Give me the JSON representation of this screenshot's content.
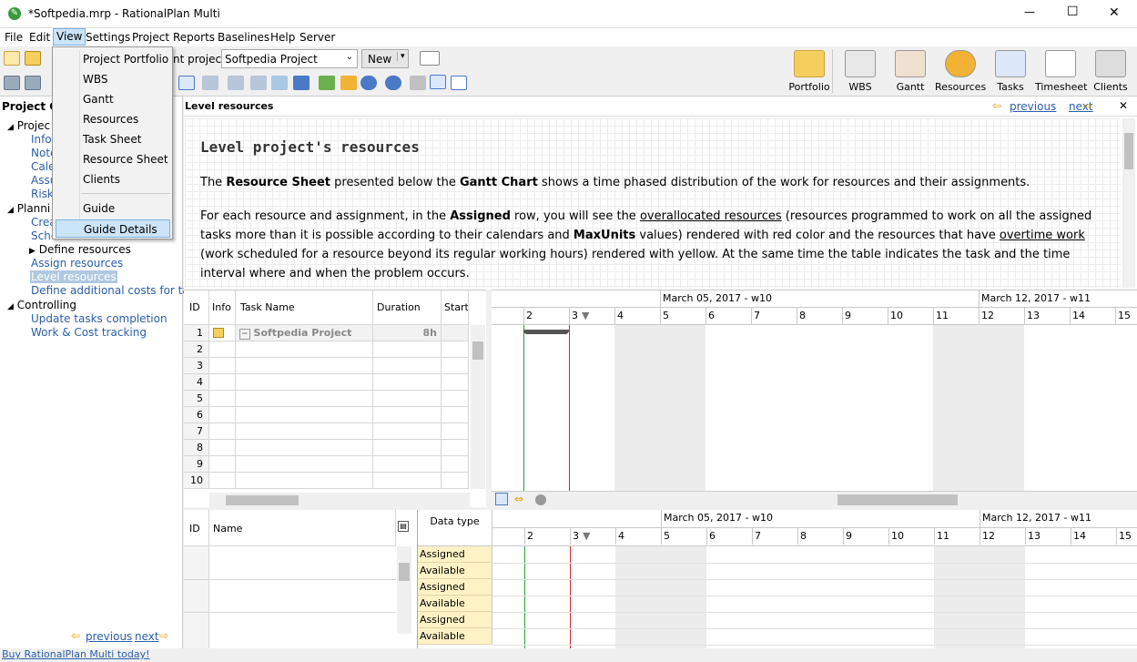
{
  "window": {
    "title": "*Softpedia.mrp - RationalPlan Multi",
    "minimize": "—",
    "maximize": "☐",
    "close": "✕"
  },
  "menu": [
    "File",
    "Edit",
    "View",
    "Settings",
    "Project",
    "Reports",
    "Baselines",
    "Help",
    "Server"
  ],
  "toolbar": {
    "project_label": "nt project:",
    "project_value": "Softpedia Project",
    "new_label": "New"
  },
  "big_buttons": [
    "Portfolio",
    "WBS",
    "Gantt",
    "Resources",
    "Tasks",
    "Timesheet",
    "Clients"
  ],
  "view_menu": {
    "items": [
      "Project Portfolio",
      "WBS",
      "Gantt",
      "Resources",
      "Task Sheet",
      "Resource Sheet",
      "Clients",
      "Guide",
      "Guide Details"
    ]
  },
  "sidebar": {
    "header": "Project Gu",
    "tree": [
      {
        "text": "Projec",
        "indent": 0,
        "expand": "open"
      },
      {
        "text": "Info",
        "indent": 1,
        "link": true
      },
      {
        "text": "Note",
        "indent": 1,
        "link": true
      },
      {
        "text": "Cale",
        "indent": 1,
        "link": true
      },
      {
        "text": "Assu",
        "indent": 1,
        "link": true
      },
      {
        "text": "Risks",
        "indent": 1,
        "link": true
      },
      {
        "text": "Planni",
        "indent": 0,
        "expand": "open"
      },
      {
        "text": "Crea",
        "indent": 1,
        "link": true
      },
      {
        "text": "Sche",
        "indent": 1,
        "link": true
      },
      {
        "text": "Define resources",
        "indent": 1,
        "expand": "closed"
      },
      {
        "text": "Assign resources",
        "indent": 1,
        "link": true
      },
      {
        "text": "Level resources",
        "indent": 1,
        "link": true,
        "selected": true
      },
      {
        "text": "Define additional costs for task",
        "indent": 1,
        "link": true
      },
      {
        "text": "Controlling",
        "indent": 0,
        "expand": "open"
      },
      {
        "text": "Update tasks completion",
        "indent": 1,
        "link": true
      },
      {
        "text": "Work & Cost tracking",
        "indent": 1,
        "link": true
      }
    ],
    "previous": "previous",
    "next": "next",
    "buy": "Buy RationalPlan Multi today!"
  },
  "guide": {
    "header": "Level resources",
    "previous": "previous",
    "next": "next",
    "heading": "Level project's resources",
    "p1": [
      "The ",
      "Resource Sheet",
      " presented below the ",
      "Gantt Chart",
      " shows a time phased distribution of the work for resources and their assignments."
    ],
    "p2": [
      "For each resource and assignment, in the ",
      "Assigned",
      " row, you will see the ",
      "overallocated resources",
      " (resources programmed to work on all the assigned tasks more than it is possible according to their calendars and ",
      "MaxUnits",
      " values) rendered with red color and the resources that have ",
      "overtime work",
      " (work scheduled for a resource beyond its regular working hours) rendered with yellow. At the same time the table indicates the task and the time interval where and when the problem occurs."
    ]
  },
  "gantt": {
    "columns": [
      "ID",
      "Info",
      "Task Name",
      "Duration",
      "Start"
    ],
    "rows": [
      {
        "id": "1",
        "name": "Softpedia Project",
        "duration": "8h"
      },
      {
        "id": "2"
      },
      {
        "id": "3"
      },
      {
        "id": "4"
      },
      {
        "id": "5"
      },
      {
        "id": "6"
      },
      {
        "id": "7"
      },
      {
        "id": "8"
      },
      {
        "id": "9"
      },
      {
        "id": "10"
      }
    ],
    "weeks": [
      "March 05, 2017 - w10",
      "March 12, 2017 - w11"
    ],
    "days": [
      "2",
      "3",
      "4",
      "5",
      "6",
      "7",
      "8",
      "9",
      "10",
      "11",
      "12",
      "13",
      "14",
      "15"
    ]
  },
  "resources": {
    "columns": [
      "ID",
      "Name"
    ],
    "data_type_header": "Data type",
    "rows": [
      "Assigned",
      "Available",
      "Assigned",
      "Available",
      "Assigned",
      "Available"
    ]
  },
  "colors": {
    "accent": "#2a5ea8",
    "menu_selected": "#cce4f7",
    "overtime": "#fff2c6",
    "weekend": "#ececec",
    "today_red": "#d62a2a",
    "start_green": "#2e9e3a"
  }
}
